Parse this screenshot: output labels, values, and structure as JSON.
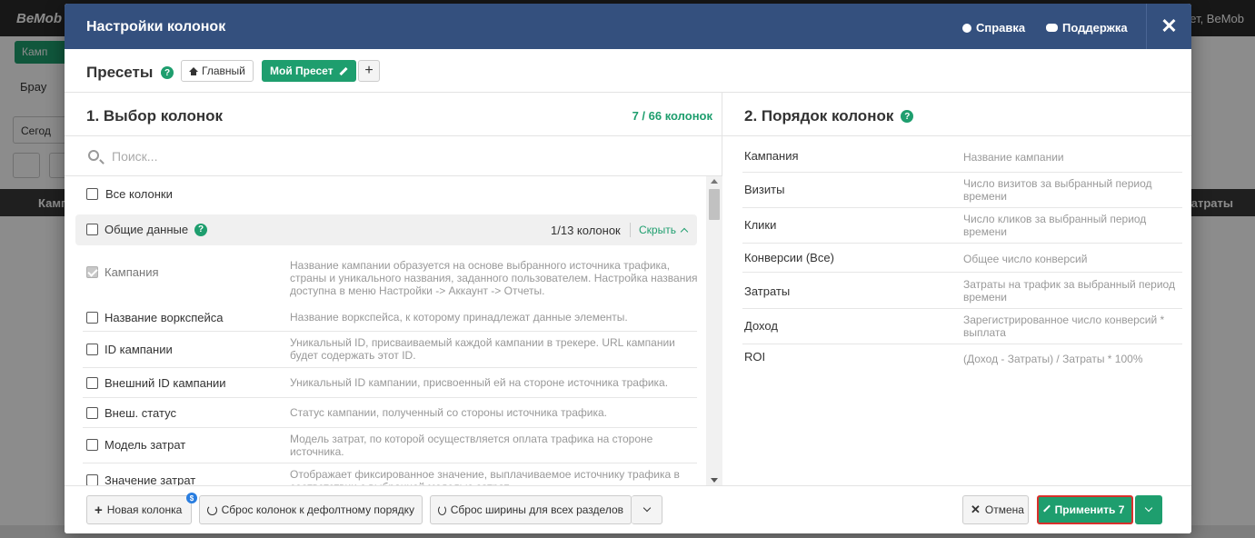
{
  "background": {
    "logo": "BeMob",
    "user": "ет, BeMob",
    "campaign_btn": "Камп",
    "browser_tab": "Брау",
    "date_btn": "Сегод",
    "table_col_campaign": "Камп",
    "table_col_costs": "Затраты",
    "flag_badge": "$"
  },
  "modal": {
    "title": "Настройки колонок",
    "help_link": "Справка",
    "support_link": "Поддержка",
    "close": "✕"
  },
  "presets": {
    "label": "Пресеты",
    "help": "?",
    "main_label": "Главный",
    "mine_label": "Мой Пресет",
    "add_label": "+"
  },
  "selection": {
    "title": "1. Выбор колонок",
    "count": "7 / 66 колонок",
    "search_placeholder": "Поиск...",
    "all_columns": "Все колонки",
    "group": {
      "name": "Общие данные",
      "help": "?",
      "count": "1/13 колонок",
      "hide": "Скрыть"
    },
    "items": [
      {
        "name": "Кампания",
        "desc": "Название кампании образуется на основе выбранного источника трафика, страны и уникального названия, заданного пользователем. Настройка названия доступна в меню Настройки -> Аккаунт -> Отчеты.",
        "checked": true,
        "disabled": true
      },
      {
        "name": "Название воркспейса",
        "desc": "Название воркспейса, к которому принадлежат данные элементы.",
        "checked": false
      },
      {
        "name": "ID кампании",
        "desc": "Уникальный ID, присваиваемый каждой кампании в трекере. URL кампании будет содержать этот ID.",
        "checked": false
      },
      {
        "name": "Внешний ID кампании",
        "desc": "Уникальный ID кампании, присвоенный ей на стороне источника трафика.",
        "checked": false
      },
      {
        "name": "Внеш. статус",
        "desc": "Статус кампании, полученный со стороны источника трафика.",
        "checked": false
      },
      {
        "name": "Модель затрат",
        "desc": "Модель затрат, по которой осуществляется оплата трафика на стороне источника.",
        "checked": false
      },
      {
        "name": "Значение затрат",
        "desc": "Отображает фиксированное значение, выплачиваемое источнику трафика в соответствии с выбранной моделью затрат.",
        "checked": false
      }
    ]
  },
  "order": {
    "title": "2. Порядок колонок",
    "help": "?",
    "rows": [
      {
        "name": "Кампания",
        "desc": "Название кампании"
      },
      {
        "name": "Визиты",
        "desc": "Число визитов за выбранный период времени"
      },
      {
        "name": "Клики",
        "desc": "Число кликов за выбранный период времени"
      },
      {
        "name": "Конверсии (Все)",
        "desc": "Общее число конверсий"
      },
      {
        "name": "Затраты",
        "desc": "Затраты на трафик за выбранный период времени"
      },
      {
        "name": "Доход",
        "desc": "Зарегистрированное число конверсий * выплата"
      },
      {
        "name": "ROI",
        "desc": "(Доход - Затраты) / Затраты * 100%"
      }
    ]
  },
  "footer": {
    "new_column": "Новая колонка",
    "new_badge": "$",
    "reset_order": "Сброс колонок к дефолтному порядку",
    "reset_width": "Сброс ширины для всех разделов",
    "cancel": "Отмена",
    "apply": "Применить 7"
  },
  "colors": {
    "header_bg": "#34507e",
    "accent_green": "#1e9e6e",
    "apply_outline": "#d9302c",
    "badge_blue": "#2a7ee0"
  }
}
